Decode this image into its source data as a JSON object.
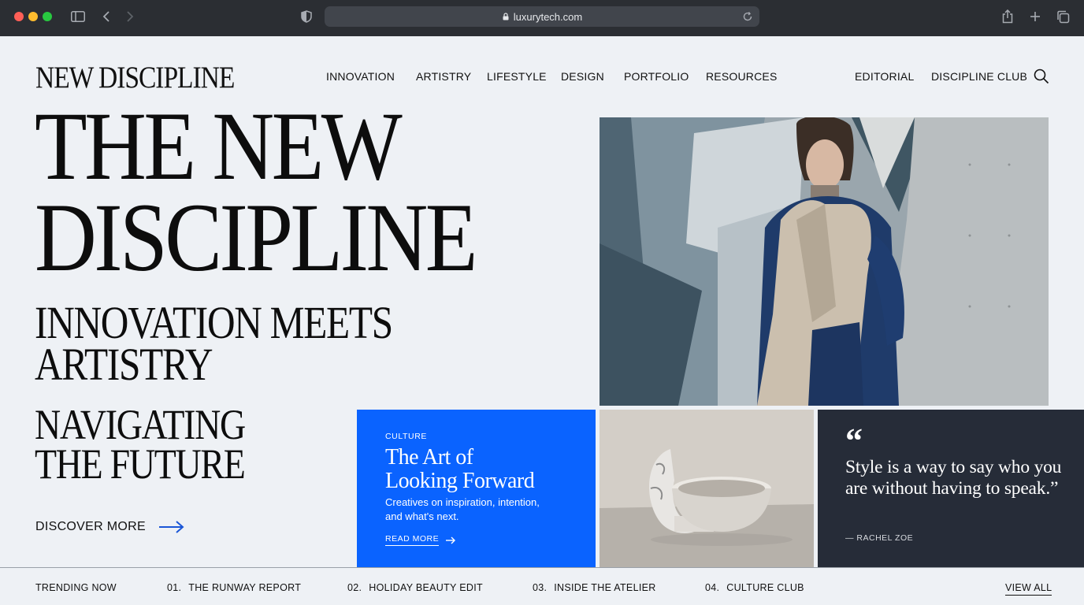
{
  "browser": {
    "url": "luxurytech.com"
  },
  "site": {
    "brand": "NEW DISCIPLINE",
    "nav": [
      "INNOVATION",
      "ARTISTRY",
      "LIFESTYLE",
      "DESIGN",
      "PORTFOLIO",
      "RESOURCES"
    ],
    "nav_right": [
      "EDITORIAL",
      "DISCIPLINE CLUB"
    ]
  },
  "hero": {
    "line1": "THE NEW",
    "line2": "DISCIPLINE",
    "sub1": "INNOVATION MEETS",
    "sub2": "ARTISTRY",
    "sub3": "NAVIGATING",
    "sub4": "THE FUTURE",
    "cta": "DISCOVER MORE"
  },
  "feature": {
    "kicker": "CULTURE",
    "title1": "The Art of",
    "title2": "Looking Forward",
    "desc": "Creatives on inspiration, intention, and what's next.",
    "cta": "READ MORE"
  },
  "quote": {
    "mark": "“",
    "text": "Style is a way to say who you are without having to speak.”",
    "author": "— RACHEL ZOE"
  },
  "trending": {
    "label": "TRENDING NOW",
    "items": [
      {
        "num": "01.",
        "title": "THE RUNWAY REPORT"
      },
      {
        "num": "02.",
        "title": "HOLIDAY BEAUTY EDIT"
      },
      {
        "num": "03.",
        "title": "INSIDE THE ATELIER"
      },
      {
        "num": "04.",
        "title": "CULTURE CLUB"
      }
    ],
    "view_all": "VIEW ALL"
  },
  "colors": {
    "background": "#eef1f5",
    "accent_blue": "#0a63ff",
    "dark_card": "#262c38",
    "chrome": "#2b2e33"
  },
  "icons": {
    "search": "search-icon",
    "arrow": "arrow-right-icon",
    "lock": "lock-icon"
  }
}
